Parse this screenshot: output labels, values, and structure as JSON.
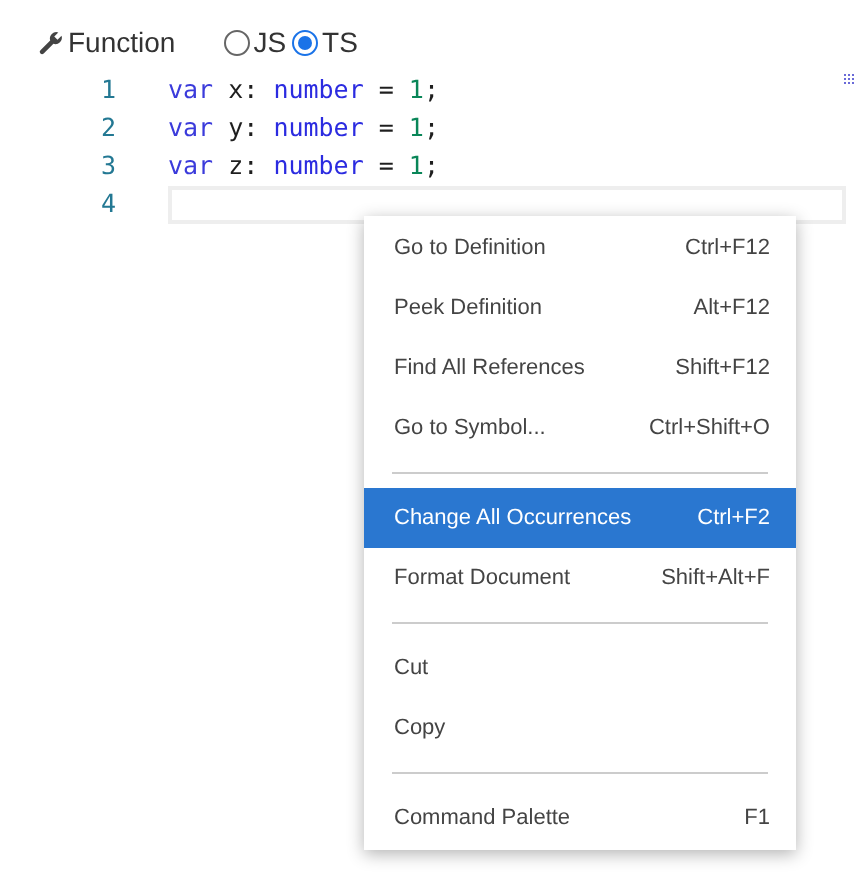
{
  "header": {
    "title": "Function",
    "languages": [
      {
        "label": "JS",
        "selected": false
      },
      {
        "label": "TS",
        "selected": true
      }
    ]
  },
  "editor": {
    "lines": [
      {
        "number": "1",
        "current": false,
        "tokens": [
          {
            "kind": "keyword",
            "text": "var"
          },
          {
            "kind": "plain",
            "text": " x: "
          },
          {
            "kind": "type",
            "text": "number"
          },
          {
            "kind": "plain",
            "text": " = "
          },
          {
            "kind": "number",
            "text": "1"
          },
          {
            "kind": "plain",
            "text": ";"
          }
        ]
      },
      {
        "number": "2",
        "current": false,
        "tokens": [
          {
            "kind": "keyword",
            "text": "var"
          },
          {
            "kind": "plain",
            "text": " y: "
          },
          {
            "kind": "type",
            "text": "number"
          },
          {
            "kind": "plain",
            "text": " = "
          },
          {
            "kind": "number",
            "text": "1"
          },
          {
            "kind": "plain",
            "text": ";"
          }
        ]
      },
      {
        "number": "3",
        "current": false,
        "tokens": [
          {
            "kind": "keyword",
            "text": "var"
          },
          {
            "kind": "plain",
            "text": " z: "
          },
          {
            "kind": "type",
            "text": "number"
          },
          {
            "kind": "plain",
            "text": " = "
          },
          {
            "kind": "number",
            "text": "1"
          },
          {
            "kind": "plain",
            "text": ";"
          }
        ]
      },
      {
        "number": "4",
        "current": true
      }
    ]
  },
  "context_menu": [
    {
      "kind": "item",
      "label": "Go to Definition",
      "shortcut": "Ctrl+F12",
      "selected": false
    },
    {
      "kind": "item",
      "label": "Peek Definition",
      "shortcut": "Alt+F12",
      "selected": false
    },
    {
      "kind": "item",
      "label": "Find All References",
      "shortcut": "Shift+F12",
      "selected": false
    },
    {
      "kind": "item",
      "label": "Go to Symbol...",
      "shortcut": "Ctrl+Shift+O",
      "selected": false
    },
    {
      "kind": "separator"
    },
    {
      "kind": "item",
      "label": "Change All Occurrences",
      "shortcut": "Ctrl+F2",
      "selected": true
    },
    {
      "kind": "item",
      "label": "Format Document",
      "shortcut": "Shift+Alt+F",
      "selected": false
    },
    {
      "kind": "separator"
    },
    {
      "kind": "item",
      "label": "Cut",
      "selected": false
    },
    {
      "kind": "item",
      "label": "Copy",
      "selected": false
    },
    {
      "kind": "separator"
    },
    {
      "kind": "item",
      "label": "Command Palette",
      "shortcut": "F1",
      "selected": false
    }
  ]
}
